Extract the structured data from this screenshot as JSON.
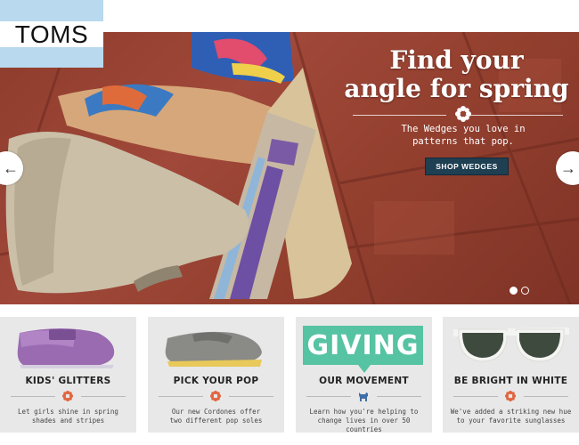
{
  "brand": {
    "logo_text": "TOMS"
  },
  "hero": {
    "title_line1": "Find your",
    "title_line2": "angle for spring",
    "subtitle_line1": "The Wedges you love in",
    "subtitle_line2": "patterns that pop.",
    "cta_label": "SHOP WEDGES",
    "prev_arrow": "←",
    "next_arrow": "→",
    "slides_total": 2,
    "active_slide": 1
  },
  "promos": [
    {
      "title": "KIDS' GLITTERS",
      "desc_line1": "Let girls shine in spring",
      "desc_line2": "shades and stripes",
      "icon": "flower-icon"
    },
    {
      "title": "PICK YOUR POP",
      "desc_line1": "Our new Cordones offer",
      "desc_line2": "two different pop soles",
      "icon": "flower-icon"
    },
    {
      "title": "OUR MOVEMENT",
      "badge": "GIVING",
      "desc_line1": "Learn how you're helping to",
      "desc_line2": "change lives in over 50 countries",
      "icon": "dog-icon"
    },
    {
      "title": "BE BRIGHT IN WHITE",
      "desc_line1": "We've added a striking new hue",
      "desc_line2": "to your favorite sunglasses",
      "icon": "flower-icon"
    }
  ],
  "colors": {
    "hero_tile": "#9a4434",
    "cta_bg": "#1f3f52",
    "accent_flower": "#e0653f",
    "giving_green": "#56c3a2",
    "tile_bg": "#e8e8e8",
    "logo_blue": "#b9d9ee"
  }
}
